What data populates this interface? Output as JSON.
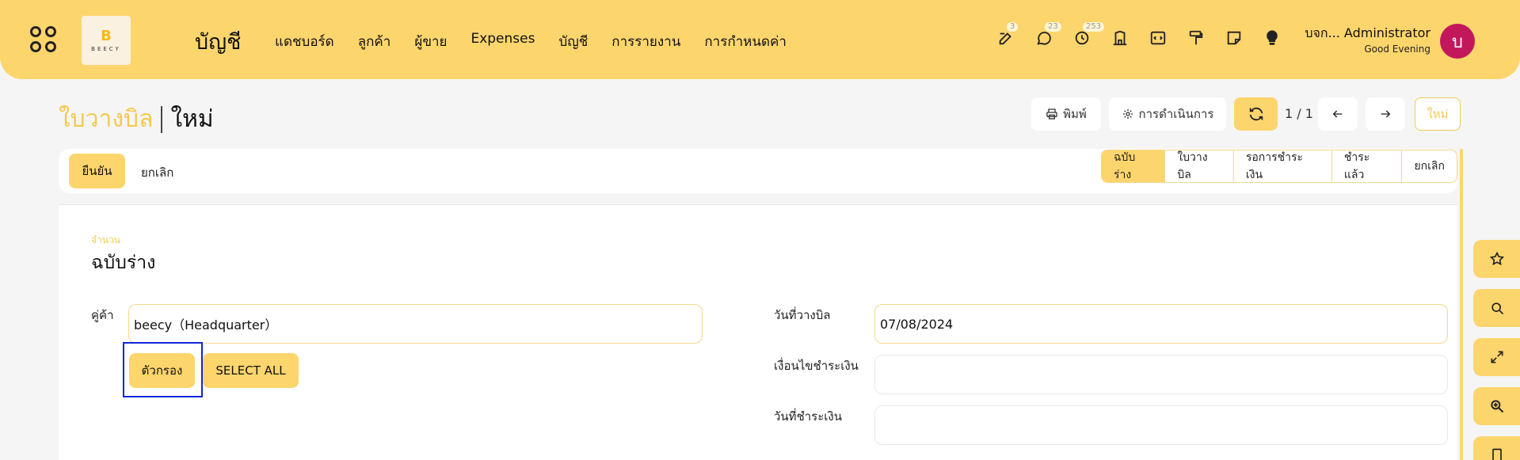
{
  "header": {
    "module_title": "บัญชี",
    "nav": [
      "แดชบอร์ด",
      "ลูกค้า",
      "ผู้ขาย",
      "Expenses",
      "บัญชี",
      "การรายงาน",
      "การกำหนดค่า"
    ],
    "logo_letter": "B",
    "logo_text": "BEECY",
    "badges": {
      "activity": "3",
      "messages": "23",
      "clock": "253"
    },
    "user_name": "บจก... Administrator",
    "greeting": "Good Evening",
    "avatar_letter": "บ"
  },
  "breadcrumb": {
    "parent": "ใบวางบิล",
    "current": "ใหม่"
  },
  "control": {
    "print_label": "พิมพ์",
    "action_label": "การดำเนินการ",
    "pager": "1 / 1",
    "new_label": "ใหม่"
  },
  "statusbar": {
    "confirm_label": "ยืนยัน",
    "cancel_label": "ยกเลิก",
    "stages": [
      "ฉบับร่าง",
      "ใบวางบิล",
      "รอการชำระเงิน",
      "ชำระแล้ว",
      "ยกเลิก"
    ],
    "active_stage": "ฉบับร่าง"
  },
  "form": {
    "number_label": "จำนวน",
    "doc_name": "ฉบับร่าง",
    "partner_label": "คู่ค้า",
    "partner_value": "beecy（Headquarter）",
    "filter_button": "ตัวกรอง",
    "select_all_button": "SELECT ALL",
    "bill_date_label": "วันที่วางบิล",
    "bill_date_value": "07/08/2024",
    "payment_term_label": "เงื่อนไขชำระเงิน",
    "payment_term_value": "",
    "payment_date_label": "วันที่ชำระเงิน",
    "payment_date_value": ""
  },
  "colors": {
    "accent": "#fdd56d",
    "avatar": "#c2185b",
    "highlight": "#1326d9"
  }
}
